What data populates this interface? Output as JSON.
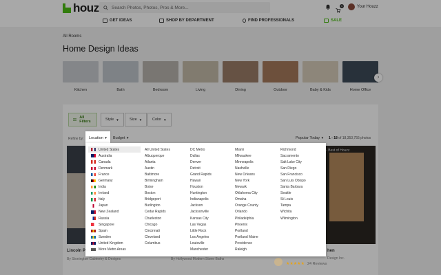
{
  "header": {
    "logo": "houzz",
    "search_placeholder": "Search Photos, Photos, Pros & More...",
    "cart_count": "1",
    "user_name": "Your Houzz"
  },
  "nav": [
    {
      "label": "GET IDEAS"
    },
    {
      "label": "SHOP BY DEPARTMENT"
    },
    {
      "label": "FIND PROFESSIONALS"
    },
    {
      "label": "SALE"
    }
  ],
  "breadcrumb": "All Rooms",
  "page_title": "Home Design Ideas",
  "categories": [
    {
      "label": "Kitchen",
      "color": "#c9ccd0"
    },
    {
      "label": "Bath",
      "color": "#bfc6cc"
    },
    {
      "label": "Bedroom",
      "color": "#b8b4ad"
    },
    {
      "label": "Living",
      "color": "#c4bba9"
    },
    {
      "label": "Dining",
      "color": "#9c7d68"
    },
    {
      "label": "Outdoor",
      "color": "#a67a5c"
    },
    {
      "label": "Baby & Kids",
      "color": "#d6cbb9"
    },
    {
      "label": "Home Office",
      "color": "#3e4b58"
    }
  ],
  "filters": {
    "all": "All Filters",
    "style": "Style",
    "size": "Size",
    "color": "Color",
    "refine_by": "Refine by:",
    "location": "Location",
    "budget": "Budget",
    "sort": "Popular Today",
    "count_range": "1 - 18",
    "count_rest": "of 18,353,755 photos"
  },
  "location_columns": [
    [
      {
        "label": "United States",
        "flag": [
          "#b22234",
          "#ffffff",
          "#3c3b6e"
        ],
        "selected": true
      },
      {
        "label": "Australia",
        "flag": [
          "#012169",
          "#012169",
          "#e4002b"
        ]
      },
      {
        "label": "Canada",
        "flag": [
          "#d52b1e",
          "#ffffff",
          "#d52b1e"
        ]
      },
      {
        "label": "Denmark",
        "flag": [
          "#c60c30",
          "#ffffff",
          "#c60c30"
        ]
      },
      {
        "label": "France",
        "flag": [
          "#0055a4",
          "#ffffff",
          "#ef4135"
        ]
      },
      {
        "label": "Germany",
        "flag": [
          "#000000",
          "#dd0000",
          "#ffce00"
        ]
      },
      {
        "label": "India",
        "flag": [
          "#ff9933",
          "#ffffff",
          "#138808"
        ]
      },
      {
        "label": "Ireland",
        "flag": [
          "#169b62",
          "#ffffff",
          "#ff883e"
        ]
      },
      {
        "label": "Italy",
        "flag": [
          "#009246",
          "#ffffff",
          "#ce2b37"
        ]
      },
      {
        "label": "Japan",
        "flag": [
          "#ffffff",
          "#bc002d",
          "#ffffff"
        ]
      },
      {
        "label": "New Zealand",
        "flag": [
          "#012169",
          "#012169",
          "#c8102e"
        ]
      },
      {
        "label": "Russia",
        "flag": [
          "#ffffff",
          "#0039a6",
          "#d52b1e"
        ]
      },
      {
        "label": "Singapore",
        "flag": [
          "#ef3340",
          "#ef3340",
          "#ffffff"
        ]
      },
      {
        "label": "Spain",
        "flag": [
          "#aa151b",
          "#f1bf00",
          "#aa151b"
        ]
      },
      {
        "label": "Sweden",
        "flag": [
          "#006aa7",
          "#fecc00",
          "#006aa7"
        ]
      },
      {
        "label": "United Kingdom",
        "flag": [
          "#012169",
          "#c8102e",
          "#012169"
        ]
      },
      {
        "label": "More Metro Areas",
        "flag": [
          "#555555",
          "#555555",
          "#555555"
        ]
      }
    ],
    [
      "All United States",
      "Albuquerque",
      "Atlanta",
      "Austin",
      "Baltimore",
      "Birmingham",
      "Boise",
      "Boston",
      "Bridgeport",
      "Burlington",
      "Cedar Rapids",
      "Charleston",
      "Chicago",
      "Cincinnati",
      "Cleveland",
      "Columbus"
    ],
    [
      "DC Metro",
      "Dallas",
      "Denver",
      "Detroit",
      "Grand Rapids",
      "Hawaii",
      "Houston",
      "Huntington",
      "Indianapolis",
      "Jackson",
      "Jacksonville",
      "Kansas City",
      "Las Vegas",
      "Little Rock",
      "Los Angeles",
      "Louisville",
      "Manchester"
    ],
    [
      "Miami",
      "Milwaukee",
      "Minneapolis",
      "Nashville",
      "New Orleans",
      "New York",
      "Newark",
      "Oklahoma City",
      "Omaha",
      "Orange County",
      "Orlando",
      "Philadelphia",
      "Phoenix",
      "Portland",
      "Portland Maine",
      "Providence",
      "Raleigh"
    ],
    [
      "Richmond",
      "Sacramento",
      "Salt Lake City",
      "San Diego",
      "San Francisco",
      "San Luis Obispo",
      "Santa Barbara",
      "Seattle",
      "St Louis",
      "Tampa",
      "Wichita",
      "Wilmington"
    ]
  ],
  "cards": {
    "left_title": "Lincoln Pr",
    "left_sub": "By Stonington Cabinetry & Designs",
    "mid_sub": "By Hollywood Modern Stone Baths",
    "right_title": "hen",
    "right_sub": "Design Inc.",
    "right_reviews": "24 Reviews",
    "right_badge": "ter - Best of Houzz"
  }
}
